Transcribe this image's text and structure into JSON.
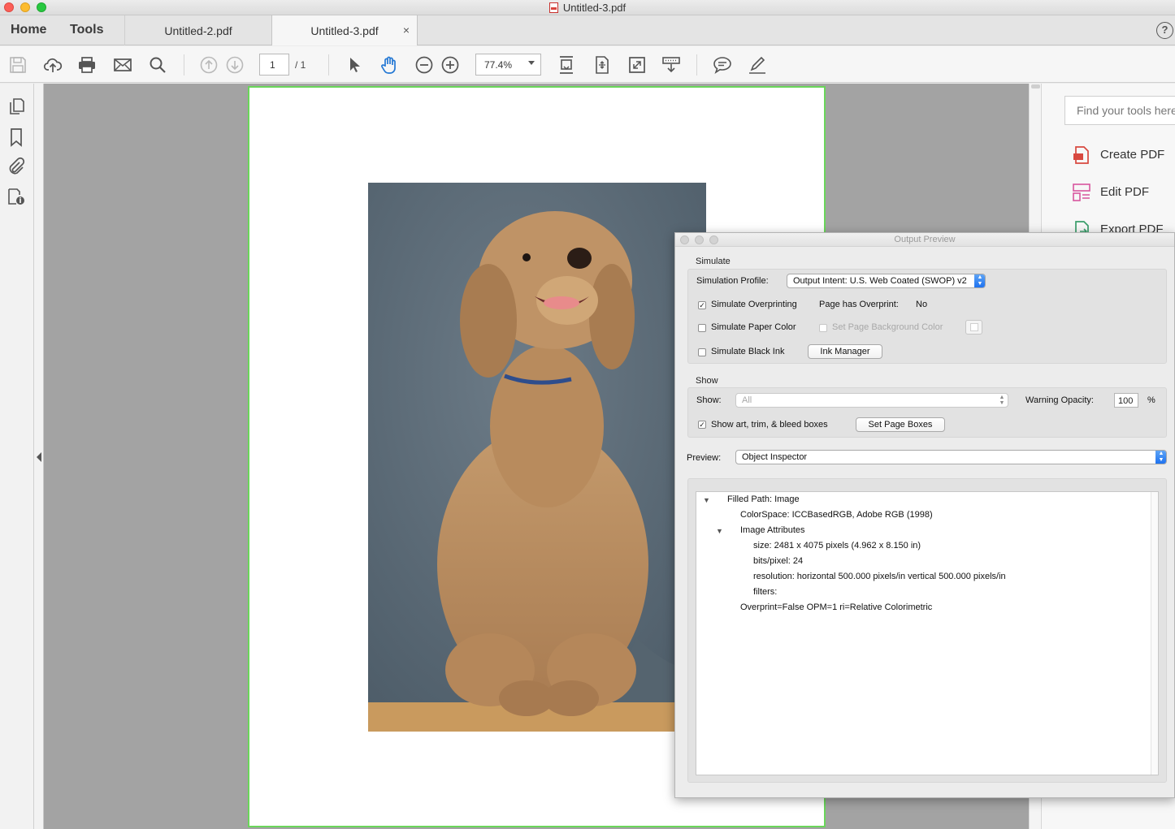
{
  "window": {
    "title": "Untitled-3.pdf"
  },
  "tabbar": {
    "home_label": "Home",
    "tools_label": "Tools",
    "tabs": [
      {
        "label": "Untitled-2.pdf"
      },
      {
        "label": "Untitled-3.pdf",
        "close": "×"
      }
    ],
    "help": "?"
  },
  "toolbar": {
    "page_number": "1",
    "page_total": "/ 1",
    "zoom": "77.4%"
  },
  "right_pane": {
    "search_placeholder": "Find your tools here",
    "tools": [
      {
        "label": "Create PDF",
        "icon": "create-pdf-icon"
      },
      {
        "label": "Edit PDF",
        "icon": "edit-pdf-icon"
      },
      {
        "label": "Export PDF",
        "icon": "export-pdf-icon"
      }
    ]
  },
  "dialog": {
    "title": "Output Preview",
    "simulate": {
      "section_label": "Simulate",
      "profile_label": "Simulation Profile:",
      "profile_value": "Output Intent: U.S. Web Coated (SWOP) v2",
      "overprinting_label": "Simulate Overprinting",
      "overprinting_checked": true,
      "page_has_overprint_label": "Page has Overprint:",
      "page_has_overprint_value": "No",
      "paper_color_label": "Simulate Paper Color",
      "page_bg_label": "Set Page Background Color",
      "black_ink_label": "Simulate Black Ink",
      "ink_manager_label": "Ink Manager"
    },
    "show": {
      "section_label": "Show",
      "show_label": "Show:",
      "show_value": "All",
      "warning_opacity_label": "Warning Opacity:",
      "warning_opacity_value": "100",
      "percent": "%",
      "boxes_label": "Show art, trim, & bleed boxes",
      "boxes_checked": true,
      "set_page_boxes_label": "Set Page Boxes"
    },
    "preview": {
      "label": "Preview:",
      "value": "Object Inspector"
    },
    "inspector": {
      "filled_path": "Filled Path: Image",
      "colorspace": "ColorSpace: ICCBasedRGB, Adobe RGB (1998)",
      "image_attributes": "Image Attributes",
      "size": "size: 2481 x 4075 pixels (4.962 x 8.150 in)",
      "bits": "bits/pixel: 24",
      "resolution": "resolution: horizontal 500.000 pixels/in vertical 500.000 pixels/in",
      "filters": "filters:",
      "overprint": "Overprint=False OPM=1 ri=Relative Colorimetric"
    }
  },
  "colors": {
    "accent": "#1a6ff0",
    "page_border": "#6ad65a",
    "hand_tool": "#2478d4",
    "canvas": "#a3a3a3"
  }
}
